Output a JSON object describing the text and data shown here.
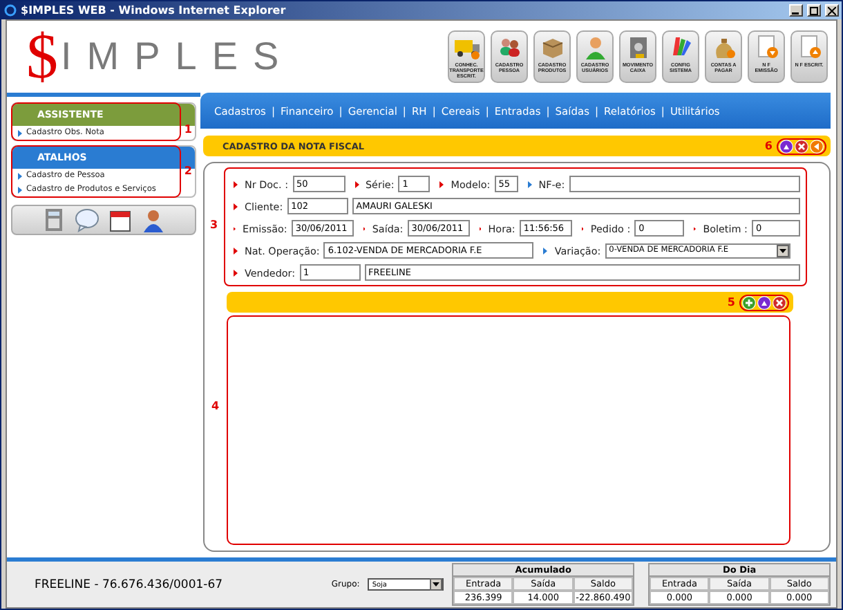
{
  "window": {
    "title": "$IMPLES WEB - Windows Internet Explorer"
  },
  "logo": {
    "mark": "$",
    "text": "IMPLES"
  },
  "toolbar": [
    {
      "kind": "truck",
      "label": "CONHEC. TRANSPORTE ESCRIT."
    },
    {
      "kind": "people",
      "label": "CADASTRO PESSOA"
    },
    {
      "kind": "box",
      "label": "CADASTRO PRODUTOS"
    },
    {
      "kind": "user",
      "label": "CADASTRO USUÁRIOS"
    },
    {
      "kind": "safe",
      "label": "MOVIMENTO CAIXA"
    },
    {
      "kind": "palette",
      "label": "CONFIG SISTEMA"
    },
    {
      "kind": "moneybag",
      "label": "CONTAS A PAGAR"
    },
    {
      "kind": "doc-down",
      "label": "N F EMISSÃO"
    },
    {
      "kind": "doc-up",
      "label": "N F ESCRIT."
    }
  ],
  "menu": {
    "separator": "|",
    "items": [
      "Cadastros",
      "Financeiro",
      "Gerencial",
      "RH",
      "Cereais",
      "Entradas",
      "Saídas",
      "Relatórios",
      "Utilitários"
    ]
  },
  "sidebar": {
    "panels": [
      {
        "title": "ASSISTENTE",
        "color": "#7c9c3c",
        "annotation": "1",
        "items": [
          "Cadastro Obs. Nota"
        ]
      },
      {
        "title": "ATALHOS",
        "color": "#2a7cd2",
        "annotation": "2",
        "items": [
          "Cadastro de Pessoa",
          "Cadastro de Produtos e Serviços"
        ]
      }
    ],
    "tools": [
      {
        "kind": "calculator"
      },
      {
        "kind": "chat"
      },
      {
        "kind": "calendar"
      },
      {
        "kind": "person"
      }
    ]
  },
  "form_panel": {
    "title": "CADASTRO DA NOTA FISCAL",
    "annotation": "6",
    "actions": [
      {
        "kind": "up"
      },
      {
        "kind": "close"
      },
      {
        "kind": "back"
      }
    ],
    "fields_annotation": "3",
    "lines": [
      {
        "fields": [
          {
            "label": "Nr Doc. :",
            "required": true,
            "value": "50"
          },
          {
            "label": "Série:",
            "required": true,
            "value": "1"
          },
          {
            "label": "Modelo:",
            "required": true,
            "value": "55"
          },
          {
            "label": "NF-e:",
            "required": false
          }
        ]
      },
      {
        "fields": [
          {
            "label": "Cliente:",
            "required": true,
            "value": "102"
          },
          {
            "value": "AMAURI GALESKI"
          }
        ]
      },
      {
        "fields": [
          {
            "label": "Emissão:",
            "required": true,
            "value": "30/06/2011"
          },
          {
            "label": "Saída:",
            "required": true,
            "value": "30/06/2011"
          },
          {
            "label": "Hora:",
            "required": true,
            "value": "11:56:56"
          },
          {
            "label": "Pedido :",
            "required": true,
            "value": "0"
          },
          {
            "label": "Boletim :",
            "required": true,
            "value": "0"
          }
        ]
      },
      {
        "fields": [
          {
            "label": "Nat. Operação:",
            "required": true,
            "value": "6.102-VENDA DE MERCADORIA F.E"
          },
          {
            "label": "Variação:",
            "required": false,
            "value": "0-VENDA DE MERCADORIA F.E",
            "kind": "select"
          }
        ]
      },
      {
        "fields": [
          {
            "label": "Vendedor:",
            "required": true,
            "value": "1"
          },
          {
            "value": "FREELINE"
          }
        ]
      }
    ]
  },
  "detail_panel": {
    "annotation": "5",
    "actions": [
      {
        "kind": "add"
      },
      {
        "kind": "up"
      },
      {
        "kind": "close"
      }
    ],
    "grid_annotation": "4"
  },
  "status_bar": {
    "company": "FREELINE - 76.676.436/0001-67",
    "group_label": "Grupo:",
    "group_value": "Soja",
    "tables": [
      {
        "title": "Acumulado",
        "columns": [
          "Entrada",
          "Saída",
          "Saldo"
        ],
        "values": [
          "236.399",
          "14.000",
          "-22.860.490"
        ]
      },
      {
        "title": "Do Dia",
        "columns": [
          "Entrada",
          "Saída",
          "Saldo"
        ],
        "values": [
          "0.000",
          "0.000",
          "0.000"
        ]
      }
    ]
  }
}
